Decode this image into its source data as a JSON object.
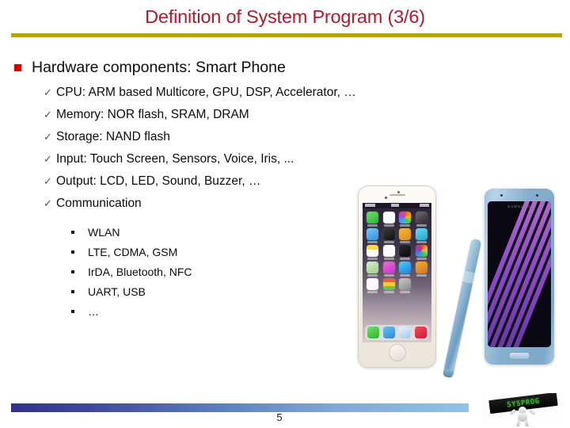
{
  "slide": {
    "title": "Definition of System Program (3/6)",
    "title_color": "#b5192b",
    "rule_color": "#b8a017",
    "level1": {
      "marker": "square-bullet-icon",
      "text": "Hardware components: Smart Phone",
      "marker_color": "#d40000"
    },
    "level2": {
      "marker": "checkmark-icon",
      "items": [
        "CPU: ARM based Multicore, GPU, DSP, Accelerator, …",
        "Memory: NOR flash, SRAM, DRAM",
        "Storage: NAND flash",
        "Input: Touch Screen, Sensors, Voice, Iris, ...",
        "Output: LCD, LED, Sound, Buzzer, …",
        "Communication"
      ]
    },
    "level3": {
      "marker": "small-square-bullet-icon",
      "items": [
        "WLAN",
        "LTE, CDMA, GSM",
        "IrDA, Bluetooth, NFC",
        "UART, USB",
        "…"
      ]
    },
    "images": {
      "phone_white": "iphone-product-photo",
      "phone_blue": "galaxy-note-product-photo",
      "stylus": "s-pen-stylus"
    },
    "footer": {
      "page_number": "5",
      "bar_gradient_start": "#2f3192",
      "bar_gradient_end": "#93c1ea",
      "logo_text": "SYSPROG",
      "logo_text_color": "#3fae3f"
    }
  }
}
